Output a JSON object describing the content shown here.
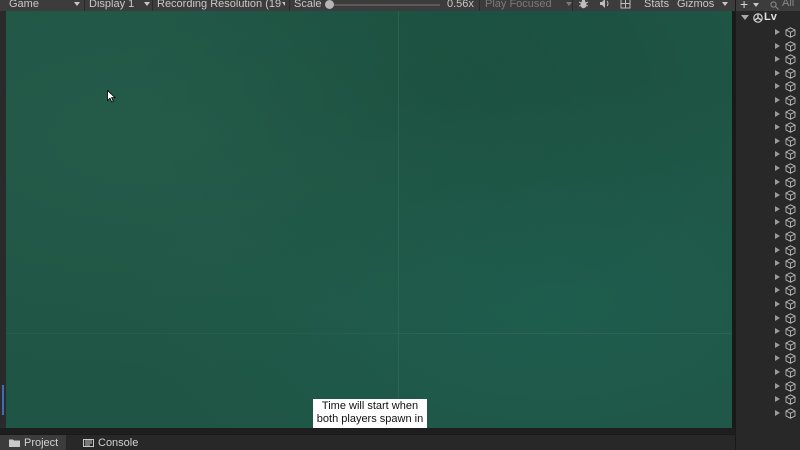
{
  "toolbar": {
    "game_tab": "Game",
    "display": "Display 1",
    "resolution": "Recording Resolution (19",
    "scale_label": "Scale",
    "scale_value": "0.56x",
    "play_mode": "Play Focused",
    "stats": "Stats",
    "gizmos": "Gizmos"
  },
  "game": {
    "notice_line1": "Time will start when",
    "notice_line2": "both players spawn in"
  },
  "bottom_tabs": {
    "project": "Project",
    "console": "Console"
  },
  "hierarchy": {
    "add": "+",
    "search": "All",
    "scene": "Lv",
    "row_count": 29
  },
  "colors": {
    "game_background": "#1f5545",
    "editor_dark": "#282828",
    "toolbar": "#3c3c3c",
    "accent": "#3d6fb5"
  }
}
